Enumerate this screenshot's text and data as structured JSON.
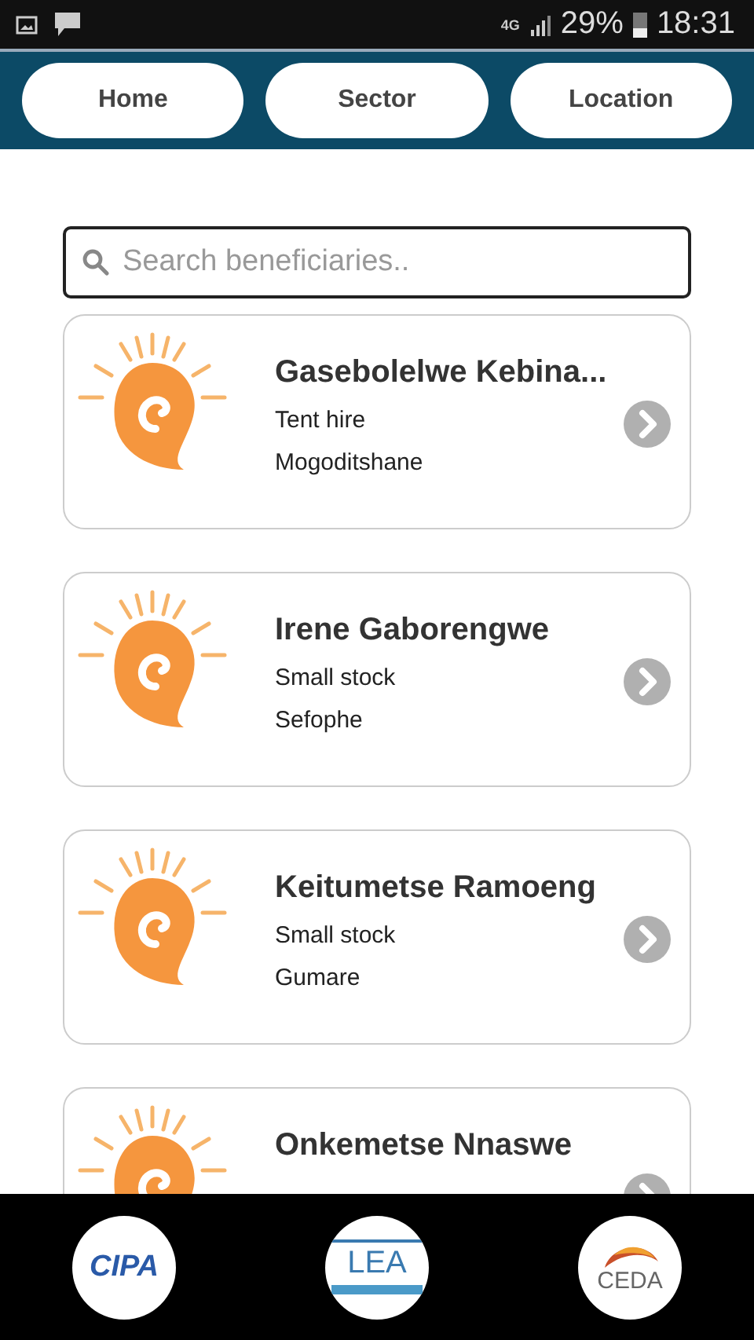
{
  "status_bar": {
    "network": "4G",
    "battery": "29%",
    "time": "18:31"
  },
  "tabs": [
    {
      "label": "Home"
    },
    {
      "label": "Sector"
    },
    {
      "label": "Location"
    }
  ],
  "search": {
    "placeholder": "Search beneficiaries.."
  },
  "beneficiaries": [
    {
      "name": "Gasebolelwe Kebina...",
      "sector": "Tent hire",
      "location": "Mogoditshane"
    },
    {
      "name": "Irene Gaborengwe",
      "sector": "Small stock",
      "location": "Sefophe"
    },
    {
      "name": "Keitumetse Ramoeng",
      "sector": "Small stock",
      "location": "Gumare"
    },
    {
      "name": "Onkemetse Nnaswe"
    }
  ],
  "partners": [
    {
      "kind": "cipa",
      "label": "CIPA"
    },
    {
      "kind": "lea",
      "label": "LEA"
    },
    {
      "kind": "ceda",
      "label": "CEDA"
    }
  ]
}
